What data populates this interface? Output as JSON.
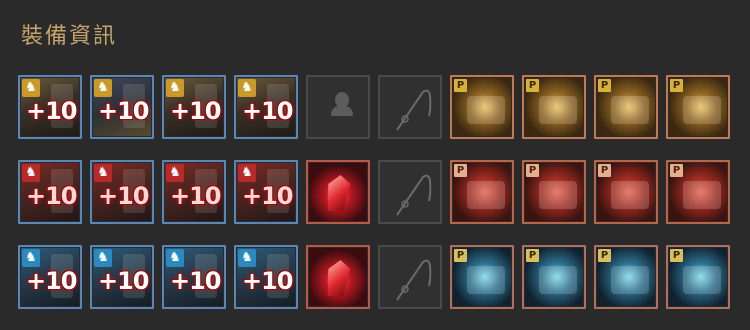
{
  "panel": {
    "title": "裝備資訊"
  },
  "rows": [
    {
      "gear": [
        {
          "badge": "♞",
          "enhance": "+10",
          "icon": "armor-icon"
        },
        {
          "badge": "♞",
          "enhance": "+10",
          "icon": "mount-armor-icon"
        },
        {
          "badge": "♞",
          "enhance": "+10",
          "icon": "shield-icon"
        },
        {
          "badge": "♞",
          "enhance": "+10",
          "icon": "saddle-icon"
        }
      ],
      "specials": [
        {
          "type": "empty",
          "icon": "helmet-silhouette-icon"
        },
        {
          "type": "empty",
          "icon": "fishing-rod-icon"
        }
      ],
      "ships": [
        {
          "p": "P",
          "icon": "ship-hull-icon"
        },
        {
          "p": "P",
          "icon": "horse-figurehead-icon"
        },
        {
          "p": "P",
          "icon": "cannon-icon"
        },
        {
          "p": "P",
          "icon": "ship-deck-icon"
        }
      ]
    },
    {
      "gear": [
        {
          "badge": "♞",
          "enhance": "+10",
          "icon": "armor-icon"
        },
        {
          "badge": "♞",
          "enhance": "+10",
          "icon": "mount-armor-icon"
        },
        {
          "badge": "♞",
          "enhance": "+10",
          "icon": "shield-icon"
        },
        {
          "badge": "♞",
          "enhance": "+10",
          "icon": "saddle-icon"
        }
      ],
      "specials": [
        {
          "type": "crystal",
          "icon": "red-crystal-icon"
        },
        {
          "type": "empty",
          "icon": "fishing-rod-icon"
        }
      ],
      "ships": [
        {
          "p": "P",
          "icon": "ship-hull-icon"
        },
        {
          "p": "P",
          "icon": "dragon-figurehead-icon"
        },
        {
          "p": "P",
          "icon": "cannon-icon"
        },
        {
          "p": "P",
          "icon": "ship-deck-icon"
        }
      ]
    },
    {
      "gear": [
        {
          "badge": "♞",
          "enhance": "+10",
          "icon": "armor-icon"
        },
        {
          "badge": "♞",
          "enhance": "+10",
          "icon": "mount-armor-icon"
        },
        {
          "badge": "♞",
          "enhance": "+10",
          "icon": "shield-icon"
        },
        {
          "badge": "♞",
          "enhance": "+10",
          "icon": "saddle-icon"
        }
      ],
      "specials": [
        {
          "type": "crystal",
          "icon": "red-crystal-icon"
        },
        {
          "type": "empty",
          "icon": "fishing-rod-icon"
        }
      ],
      "ships": [
        {
          "p": "P",
          "icon": "ship-hull-icon"
        },
        {
          "p": "P",
          "icon": "eagle-figurehead-icon"
        },
        {
          "p": "P",
          "icon": "cannon-icon"
        },
        {
          "p": "P",
          "icon": "ship-deck-icon"
        }
      ]
    }
  ]
}
